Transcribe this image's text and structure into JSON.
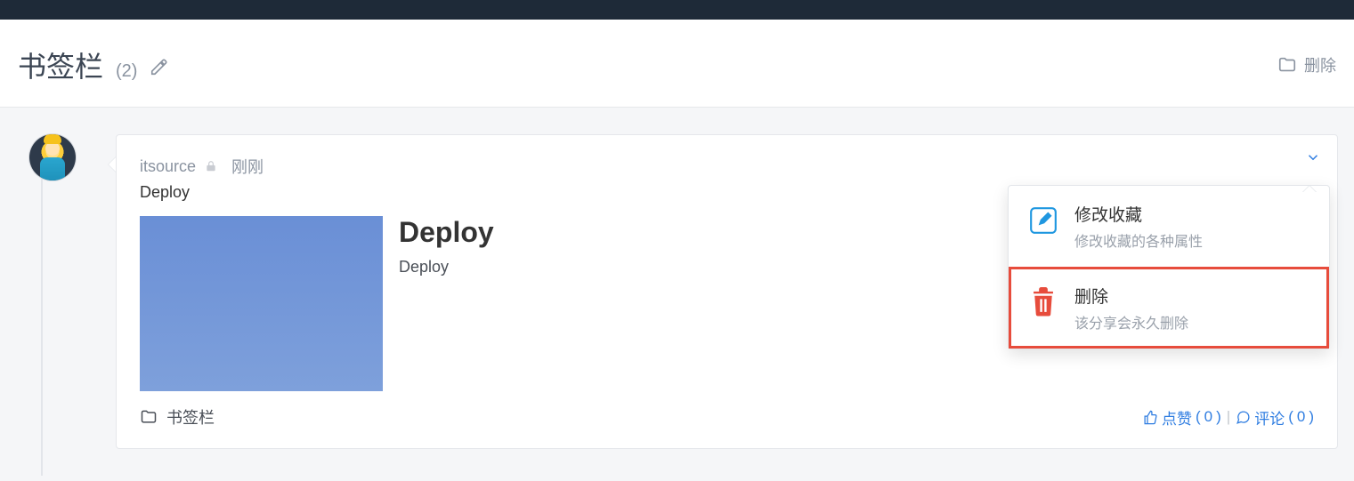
{
  "header": {
    "title": "书签栏",
    "count": "(2)",
    "delete_label": "删除"
  },
  "post": {
    "author": "itsource",
    "time": "刚刚",
    "link_title": "Deploy",
    "preview_title": "Deploy",
    "preview_subtitle": "Deploy",
    "folder": "书签栏",
    "like_label": "点赞",
    "like_count": "0",
    "comment_label": "评论",
    "comment_count": "0"
  },
  "dropdown": {
    "edit": {
      "title": "修改收藏",
      "sub": "修改收藏的各种属性"
    },
    "delete": {
      "title": "删除",
      "sub": "该分享会永久删除"
    }
  }
}
